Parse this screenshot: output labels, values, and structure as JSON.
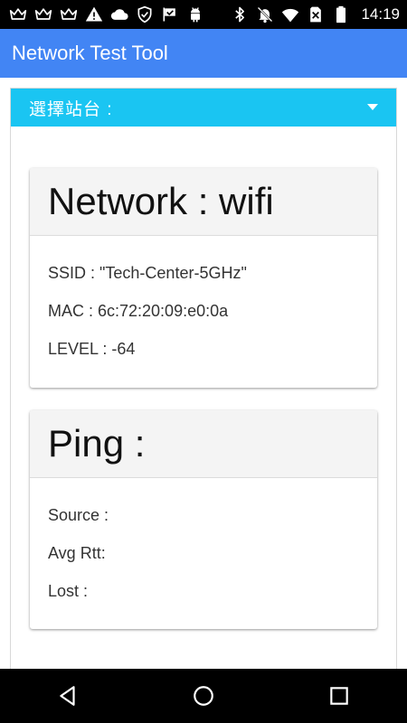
{
  "status_bar": {
    "time": "14:19",
    "left_icons": [
      "crown-icon",
      "crown-icon",
      "crown-icon",
      "warning-icon",
      "cloud-icon",
      "shield-icon",
      "check-flag-icon",
      "android-icon"
    ],
    "right_icons": [
      "bluetooth-icon",
      "notifications-off-icon",
      "wifi-icon",
      "no-sim-icon",
      "battery-icon"
    ]
  },
  "app_bar": {
    "title": "Network Test Tool",
    "color": "#4285f4"
  },
  "spinner": {
    "label": "選擇站台 :",
    "color": "#1ac5f2"
  },
  "network_card": {
    "title": "Network : wifi",
    "ssid": "SSID : \"Tech-Center-5GHz\"",
    "mac": "MAC : 6c:72:20:09:e0:0a",
    "level": "LEVEL : -64"
  },
  "ping_card": {
    "title": "Ping :",
    "source": "Source :",
    "avg_rtt": "Avg Rtt:",
    "lost": "Lost :"
  },
  "nav_bar": {
    "buttons": [
      "back-icon",
      "home-icon",
      "recents-icon"
    ]
  }
}
